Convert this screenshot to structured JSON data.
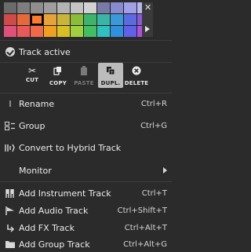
{
  "palette": {
    "rows": [
      [
        "#6b6b6b",
        "#7e7e7e",
        "#8f8f8f",
        "#9e9e9e",
        "#b3b3b3",
        "#c4c4c4",
        "#d2d2d2",
        "#7a7aa8",
        "#8a8ad0",
        "#a0a0e8",
        "#b7b7f0"
      ],
      [
        "#d14a4a",
        "#e56a3a",
        "#ff7a2a",
        "#e8a23a",
        "#c9b53a",
        "#8cbd3a",
        "#3ab56a",
        "#3ab5a5",
        "#3a9ad9",
        "#5a6ae0",
        "#8a5ad9"
      ],
      [
        "#e0507a",
        "#e85a5a",
        "#f06a4a",
        "#f0a020",
        "#d8c020",
        "#a0d040",
        "#40c060",
        "#30c0c0",
        "#3090e0",
        "#6060e8",
        "#b050e0"
      ]
    ],
    "selected_row": 1,
    "selected_col": 2
  },
  "track_active": {
    "label": "Track active"
  },
  "edit_buttons": [
    {
      "label": "CUT",
      "icon": "scissors-icon",
      "enabled": true,
      "active": false
    },
    {
      "label": "COPY",
      "icon": "copy-icon",
      "enabled": true,
      "active": false
    },
    {
      "label": "PASTE",
      "icon": "clipboard-icon",
      "enabled": false,
      "active": false
    },
    {
      "label": "DUPL.",
      "icon": "duplicate-icon",
      "enabled": true,
      "active": true
    },
    {
      "label": "DELETE",
      "icon": "delete-icon",
      "enabled": true,
      "active": false
    }
  ],
  "menu": {
    "rename": {
      "label": "Rename",
      "shortcut": "Ctrl+R"
    },
    "group": {
      "label": "Group",
      "shortcut": "Ctrl+G"
    },
    "convert": {
      "label": "Convert to Hybrid Track"
    },
    "monitor": {
      "label": "Monitor"
    },
    "add_instrument": {
      "label": "Add Instrument Track",
      "shortcut": "Ctrl+T"
    },
    "add_audio": {
      "label": "Add Audio Track",
      "shortcut": "Ctrl+Shift+T"
    },
    "add_fx": {
      "label": "Add FX Track",
      "shortcut": "Ctrl+Alt+T"
    },
    "add_group": {
      "label": "Add Group Track",
      "shortcut": "Ctrl+Alt+G"
    }
  }
}
